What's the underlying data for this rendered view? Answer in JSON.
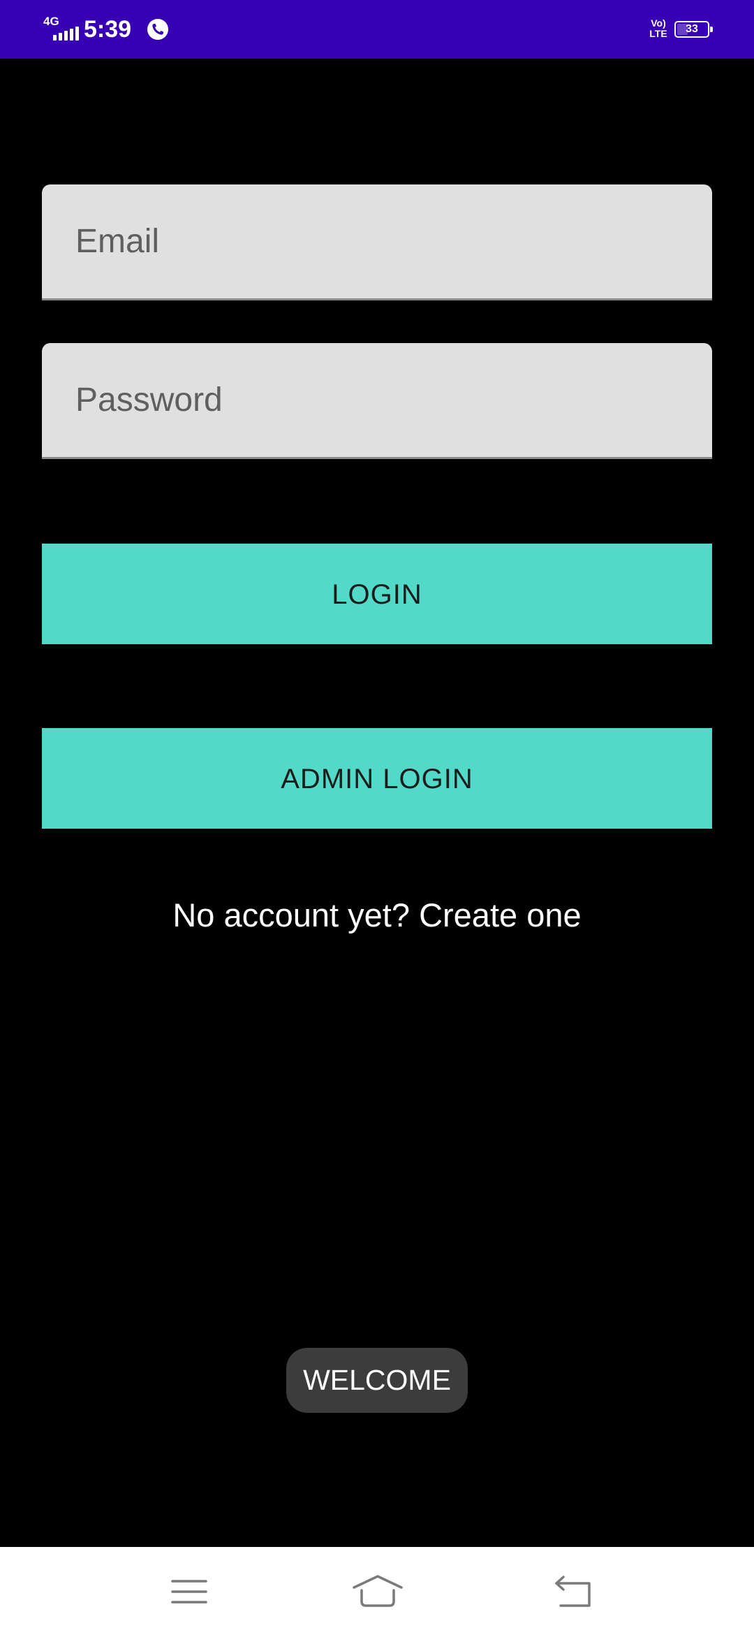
{
  "status_bar": {
    "network_type": "4G",
    "time": "5:39",
    "volte_line1": "Vo)",
    "volte_line2": "LTE",
    "battery": "33",
    "battery_level": 0.33,
    "icons": [
      "signal-icon",
      "call-icon",
      "volte-icon",
      "battery-icon"
    ]
  },
  "login_form": {
    "email_placeholder": "Email",
    "email_value": "",
    "password_placeholder": "Password",
    "password_value": "",
    "login_label": "LOGIN",
    "admin_login_label": "ADMIN LOGIN",
    "signup_text": "No account yet? Create one"
  },
  "toast": {
    "message": "WELCOME"
  },
  "nav_bar": {
    "icons": [
      "menu-icon",
      "home-icon",
      "back-icon"
    ]
  },
  "colors": {
    "status_bar": "#3700b3",
    "background": "#000000",
    "field": "#e0e0e0",
    "button": "#52d9c8",
    "toast": "#3c3c3c",
    "nav_bar": "#ffffff"
  }
}
